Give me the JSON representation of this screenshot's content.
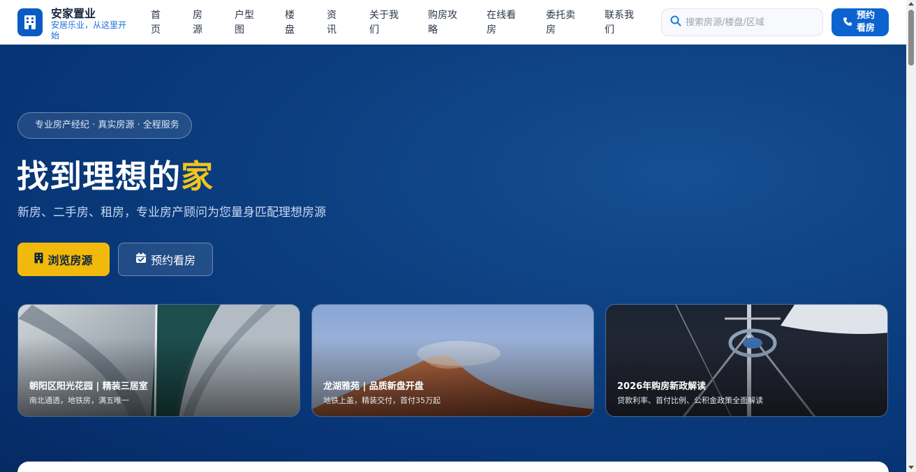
{
  "brand": {
    "name": "安家置业",
    "tagline": "安居乐业，从这里开始"
  },
  "nav": [
    {
      "line1": "首",
      "line2": "页"
    },
    {
      "line1": "房",
      "line2": "源"
    },
    {
      "line1": "户型",
      "line2": "图"
    },
    {
      "line1": "楼",
      "line2": "盘"
    },
    {
      "line1": "资",
      "line2": "讯"
    },
    {
      "line1": "关于我",
      "line2": "们"
    },
    {
      "line1": "购房攻",
      "line2": "略"
    },
    {
      "line1": "在线看",
      "line2": "房"
    },
    {
      "line1": "委托卖",
      "line2": "房"
    },
    {
      "line1": "联系我",
      "line2": "们"
    }
  ],
  "search": {
    "placeholder": "搜索房源/楼盘/区域"
  },
  "header_cta": {
    "line1": "预约",
    "line2": "看房"
  },
  "hero": {
    "badge": "专业房产经纪 · 真实房源 · 全程服务",
    "title_main": "找到理想的",
    "title_highlight": "家",
    "subtitle": "新房、二手房、租房，专业房产顾问为您量身匹配理想房源",
    "primary_button": "浏览房源",
    "secondary_button": "预约看房"
  },
  "cards": [
    {
      "title": "朝阳区阳光花园 | 精装三居室",
      "subtitle": "南北通透，地铁房，满五唯一"
    },
    {
      "title": "龙湖雅苑 | 品质新盘开盘",
      "subtitle": "地铁上盖，精装交付，首付35万起"
    },
    {
      "title": "2026年购房新政解读",
      "subtitle": "贷款利率、首付比例、公积金政策全面解读"
    }
  ],
  "colors": {
    "primary": "#0b63d0",
    "accent": "#f0b90b",
    "hero_bg": "#0a3b7c"
  }
}
